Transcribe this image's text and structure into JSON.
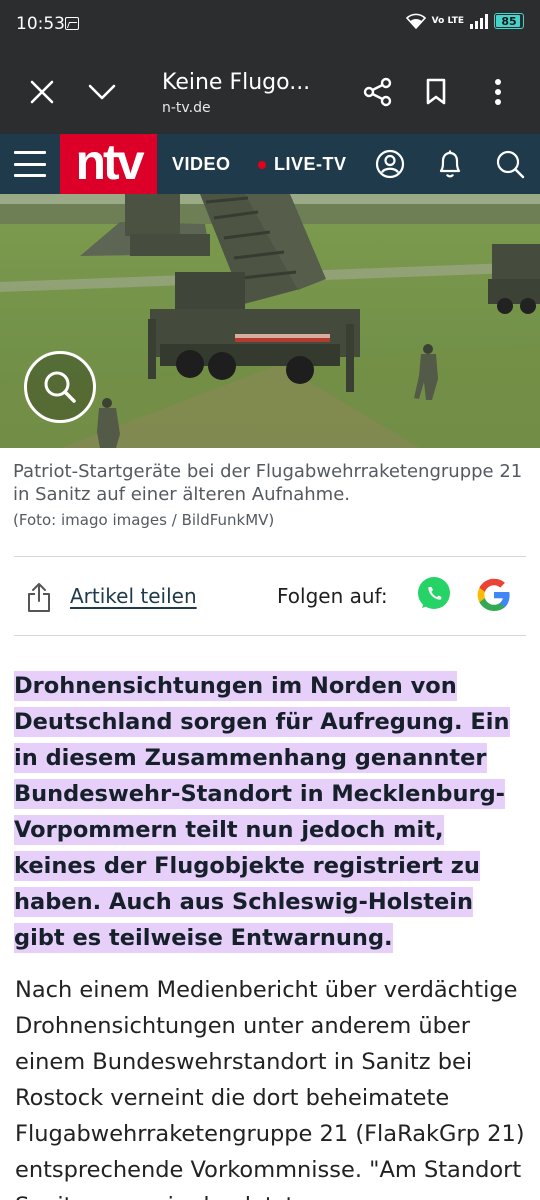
{
  "status_bar": {
    "time": "10:53",
    "network": "Vo LTE",
    "battery_level": "85"
  },
  "toolbar": {
    "title": "Keine Flugo...",
    "domain": "n-tv.de"
  },
  "header": {
    "logo": "ntv",
    "nav_video": "VIDEO",
    "nav_live": "LIVE-TV"
  },
  "article": {
    "image_caption": "Patriot-Startgeräte bei der Flugabwehrraketengruppe 21 in Sanitz auf einer älteren Aufnahme.",
    "image_credit": "(Foto: imago images / BildFunkMV)",
    "share_label": "Artikel teilen",
    "follow_label": "Folgen auf:",
    "lead": "Drohnensichtungen im Norden von Deutschland sorgen für Aufregung. Ein in diesem Zusammenhang genannter Bundeswehr-Standort in Mecklenburg-Vorpommern teilt nun jedoch mit, keines der Flugobjekte registriert zu haben. Auch aus Schleswig-Holstein gibt es teilweise Entwarnung.",
    "body": "Nach einem Medienbericht über verdächtige Drohnensichtungen unter anderem über einem Bundeswehrstandort in Sanitz bei Rostock verneint die dort beheimatete Flugabwehrraketengruppe 21 (FlaRakGrp 21) entsprechende Vorkommnisse. \"Am Standort Sanitz waren in den letzten"
  },
  "colors": {
    "toolbar_bg": "#2b2d2f",
    "ntv_header_bg": "#1f3a4a",
    "ntv_red": "#dc0028",
    "lead_highlight": "#e6cff8",
    "whatsapp": "#25d366"
  }
}
